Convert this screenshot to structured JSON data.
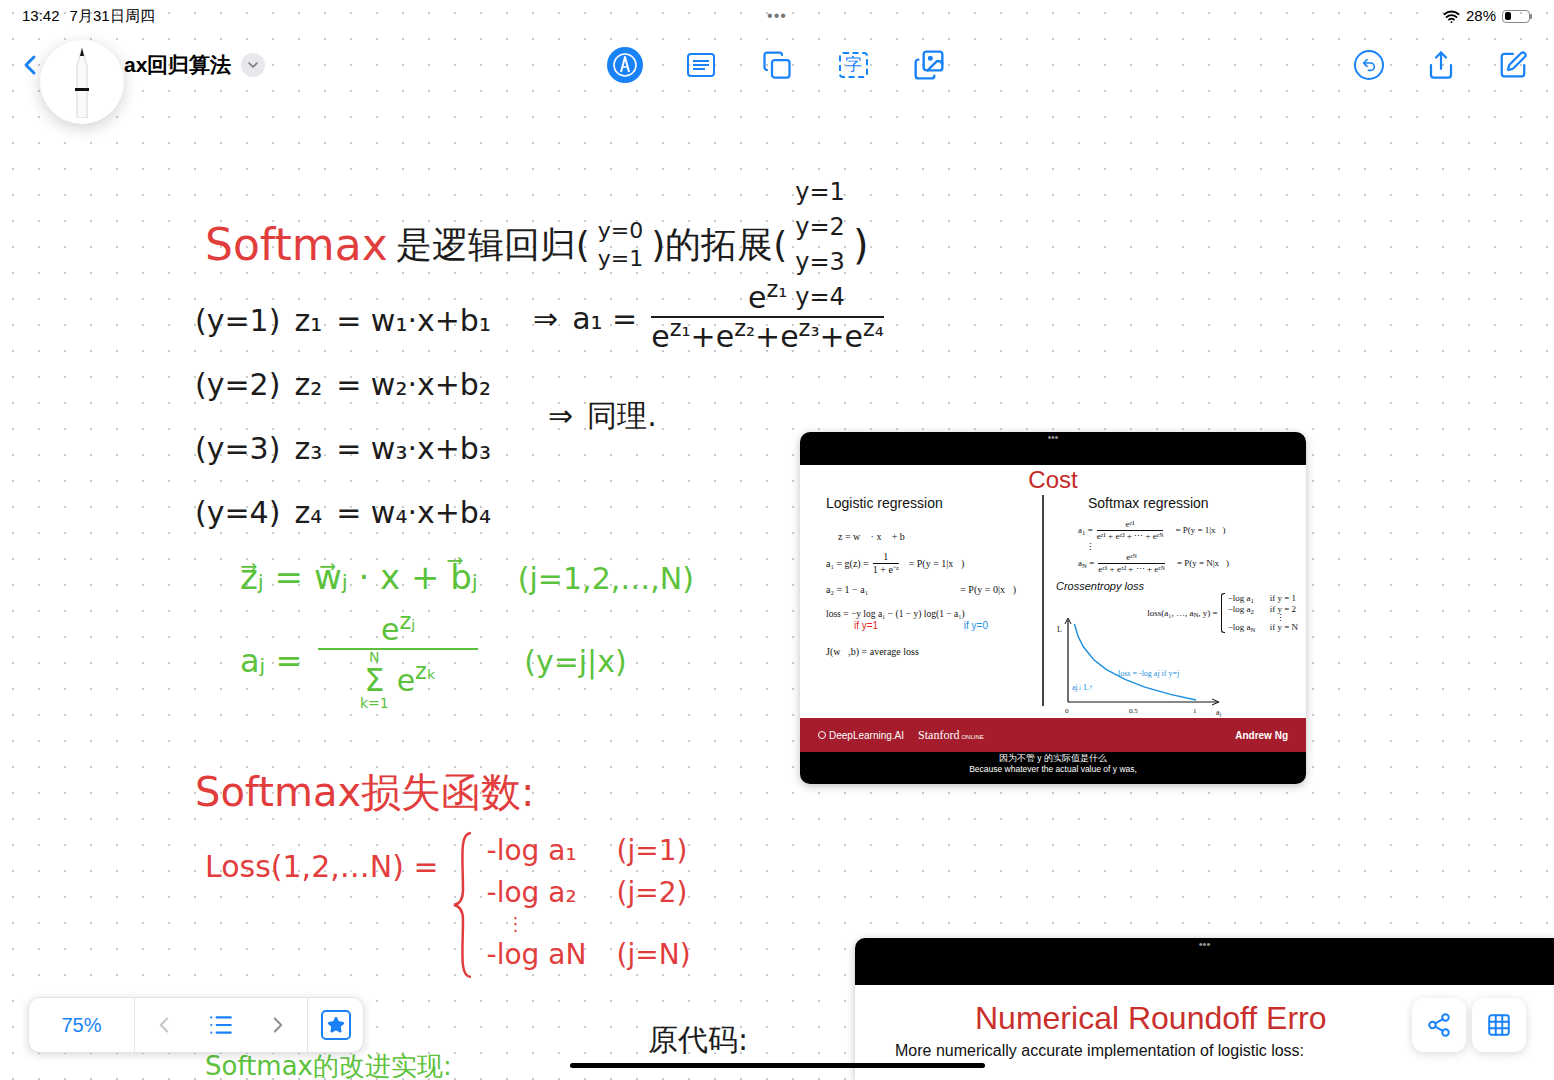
{
  "status_bar": {
    "time": "13:42",
    "date": "7月31日周四",
    "battery": "28%",
    "battery_level": 0.28,
    "handle": "•••"
  },
  "toolbar": {
    "title": "ax回归算法",
    "text_tool": "字",
    "tools": [
      {
        "kind": "pen",
        "selected": true
      },
      {
        "kind": "textbox",
        "selected": false
      },
      {
        "kind": "shapes",
        "selected": false
      },
      {
        "kind": "text",
        "selected": false
      },
      {
        "kind": "media",
        "selected": false
      }
    ]
  },
  "notes": {
    "heading": {
      "term": "Softmax",
      "text_a": "是逻辑回归(",
      "cases_a": [
        "y=0",
        "y=1"
      ],
      "text_b": ")的拓展(",
      "cases_b": [
        "y=1",
        "y=2",
        "y=3",
        "y=4"
      ],
      "text_c": ")"
    },
    "equations": [
      {
        "label": "(y=1)",
        "lhs": "z₁",
        "rhs": "= w₁·x+b₁"
      },
      {
        "label": "(y=2)",
        "lhs": "z₂",
        "rhs": "= w₂·x+b₂"
      },
      {
        "label": "(y=3)",
        "lhs": "z₃",
        "rhs": "= w₃·x+b₃"
      },
      {
        "label": "(y=4)",
        "lhs": "z₄",
        "rhs": "= w₄·x+b₄"
      }
    ],
    "softmax_a1": {
      "arrow": "⇒",
      "lhs": "a₁ =",
      "numerator": {
        "base": "e",
        "exp": "z₁"
      },
      "denominator": [
        {
          "base": "e",
          "exp": "z₁"
        },
        {
          "base": "e",
          "exp": "z₂"
        },
        {
          "base": "e",
          "exp": "z₃"
        },
        {
          "base": "e",
          "exp": "z₄"
        }
      ],
      "plus": "+"
    },
    "same_note": {
      "arrow": "⇒",
      "text": "同理."
    },
    "general_z": {
      "formula": "z⃗ⱼ = w⃗ⱼ · x + b⃗ⱼ",
      "range": "(j=1,2,…,N)"
    },
    "general_a": {
      "lhs": "aⱼ =",
      "numerator": {
        "base": "e",
        "exp": "zⱼ"
      },
      "sum": "Σ",
      "sum_top": "N",
      "sum_bottom": "k=1",
      "denominator": {
        "base": "e",
        "exp": "zₖ"
      },
      "prob": "(y=j|x)"
    },
    "loss_heading": "Softmax损失函数:",
    "loss": {
      "lhs": "Loss(1,2,…N) =",
      "cases": [
        {
          "expr": "-log a₁",
          "cond": "(j=1)"
        },
        {
          "expr": "-log a₂",
          "cond": "(j=2)"
        },
        {
          "expr": "⋮"
        },
        {
          "expr": "-log aN",
          "cond": "(j=N)"
        }
      ]
    },
    "improved_heading": "Softmax的改进实现:",
    "original_code": "原代码:"
  },
  "cost_clip": {
    "handle": "•••",
    "title": "Cost",
    "left": {
      "heading": "Logistic regression",
      "z_line": "z = w⃗ · x⃗ + b",
      "a1": {
        "lhs": "a₁ = g(z) =",
        "num": "1",
        "den": "1 + e⁻ᶻ",
        "rhs": "= P(y = 1|x⃗)"
      },
      "a2": "a₂ = 1 − a₁",
      "a2_rhs": "= P(y = 0|x⃗)",
      "loss": "loss = −y log a₁ − (1 − y) log(1 − a₁)",
      "loss_notes": [
        {
          "text": "if y=1",
          "color": "#e02020"
        },
        {
          "text": "if y=0",
          "color": "#1a8fe0"
        }
      ],
      "cost": "J(w⃗,b) = average loss"
    },
    "right": {
      "heading": "Softmax regression",
      "rows": [
        {
          "var": "a",
          "sub": "1",
          "num": "eᶻ¹",
          "den": "eᶻ¹ + eᶻ² + ⋯ + eᶻᴺ",
          "rhs": "= P(y = 1|x⃗)"
        },
        {
          "var": "a",
          "sub": "N",
          "num": "eᶻᴺ",
          "den": "eᶻ¹ + eᶻ² + ⋯ + eᶻᴺ",
          "rhs": "= P(y = N|x⃗)"
        }
      ],
      "vdots": "⋮",
      "cross_heading": "Crossentropy loss",
      "cross_lhs": {
        "text": "loss(a₁, …, a",
        "sub": "N",
        "tail": ", y) ="
      },
      "cross_cases": [
        {
          "prefix": "−log a",
          "sub": "1",
          "cond": "if y = 1"
        },
        {
          "prefix": "−log a",
          "sub": "2",
          "cond": "if y = 2"
        },
        {
          "prefix": "⋮"
        },
        {
          "prefix": "−log a",
          "sub": "N",
          "cond": "if y = N"
        }
      ],
      "chart": {
        "y_label": "L",
        "x_label": "aⱼ",
        "ticks": [
          "0",
          "0.5",
          "1"
        ],
        "annotation": "loss = -log aj if y=j",
        "trend": "aj↓ L↑",
        "x": [
          0.05,
          0.08,
          0.12,
          0.2,
          0.3,
          0.45,
          0.6,
          0.8,
          1
        ],
        "loss": [
          3,
          2.5,
          2.1,
          1.6,
          1.2,
          0.8,
          0.51,
          0.22,
          0
        ]
      }
    },
    "footer": {
      "brand": "DeepLearning.AI",
      "partner": "Stanford",
      "partner_tag": "ONLINE",
      "author": "Andrew Ng"
    },
    "subtitles": [
      "因为不管 y 的实际值是什么",
      "Because whatever the actual value of y was,"
    ]
  },
  "roundoff_clip": {
    "handle": "•••",
    "title": "Numerical Roundoff Erro",
    "subtitle": "More numerically accurate implementation of logistic loss:"
  },
  "zoom": {
    "level": "75%"
  }
}
